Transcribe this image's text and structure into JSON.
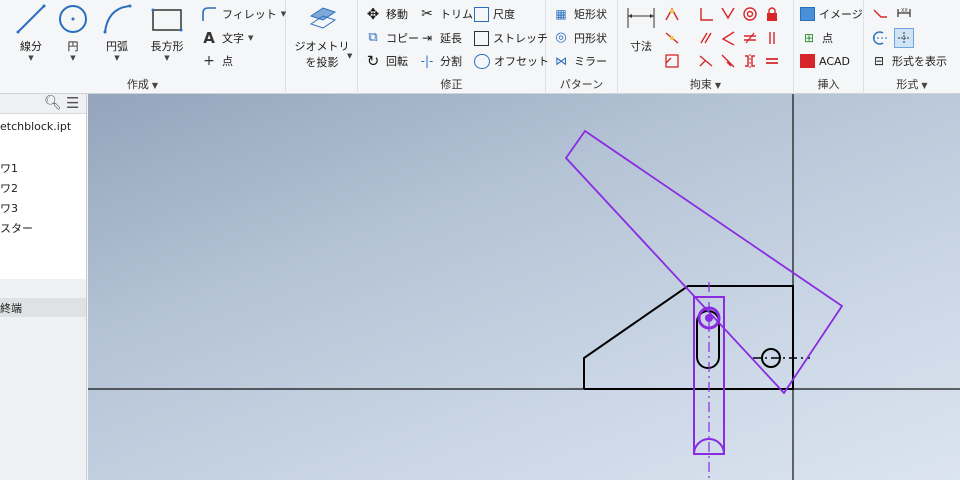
{
  "ribbon": {
    "create": {
      "title": "作成",
      "line": "線分",
      "circle": "円",
      "arc": "円弧",
      "rectangle": "長方形",
      "fillet": "フィレット",
      "text": "文字",
      "point": "点"
    },
    "project": {
      "label1": "ジオメトリ",
      "label2": "を投影"
    },
    "modify": {
      "title": "修正",
      "move": "移動",
      "copy": "コピー",
      "rotate": "回転",
      "trim": "トリム",
      "extend": "延長",
      "split": "分割",
      "scale": "尺度",
      "stretch": "ストレッチ",
      "offset": "オフセット"
    },
    "pattern": {
      "title": "パターン",
      "rect": "矩形状",
      "circular": "円形状",
      "mirror": "ミラー"
    },
    "constrain": {
      "title": "拘束",
      "dimension": "寸法"
    },
    "insert": {
      "title": "挿入",
      "image": "イメージ",
      "points": "点",
      "acad": "ACAD"
    },
    "format": {
      "title": "形式",
      "show_format": "形式を表示"
    }
  },
  "browser": {
    "file": "etchblock.ipt",
    "items": [
      "ワ1",
      "ワ2",
      "ワ3",
      "スター"
    ],
    "end": "終端"
  },
  "colors": {
    "accent": "#8a2be2",
    "constraint_red": "#d7262a",
    "sketch_black": "#000000"
  }
}
